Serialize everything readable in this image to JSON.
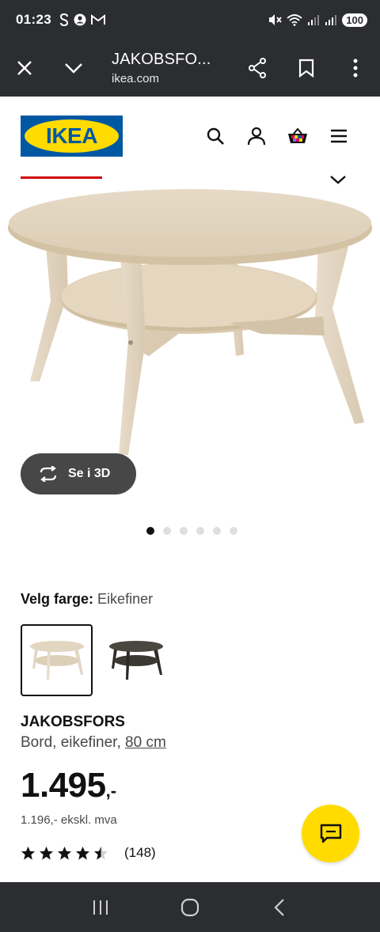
{
  "status_bar": {
    "time": "01:23",
    "battery": "100"
  },
  "browser": {
    "page_title": "JAKOBSFO...",
    "domain": "ikea.com"
  },
  "site": {
    "logo_text": "IKEA"
  },
  "gallery": {
    "view_3d_label": "Se i 3D",
    "image_count": 6,
    "active_index": 0
  },
  "color_picker": {
    "label": "Velg farge:",
    "selected_value": "Eikefiner",
    "options": [
      {
        "name": "Eikefiner",
        "color": "#e3d6c0"
      },
      {
        "name": "Mørk",
        "color": "#3b3833"
      }
    ]
  },
  "product": {
    "name": "JAKOBSFORS",
    "description": "Bord, eikefiner,",
    "size_link": "80 cm",
    "price_main": "1.495",
    "price_suffix": ",-",
    "price_ex_vat": "1.196,- ekskl. mva",
    "rating_value": 4.5,
    "review_count": "(148)"
  },
  "colors": {
    "brand_blue": "#0058a3",
    "brand_yellow": "#ffdb00",
    "tab_indicator": "#cc0008",
    "dark_chrome": "#2b2d31"
  }
}
